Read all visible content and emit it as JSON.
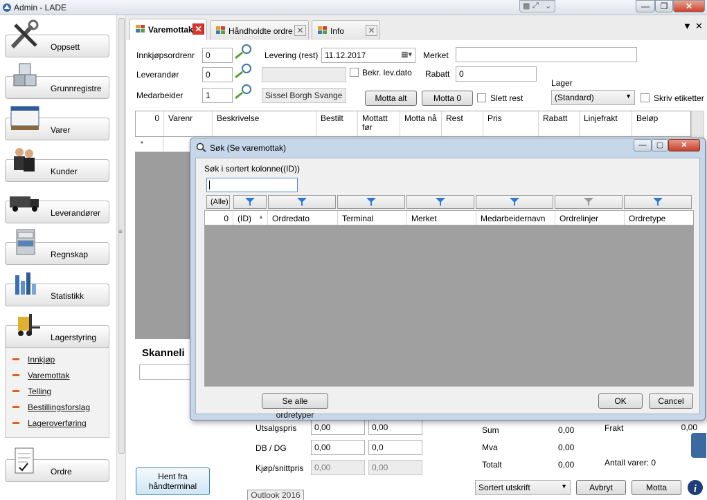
{
  "window": {
    "title": "Admin - LADE",
    "minimize": "—",
    "maximize": "❐",
    "close": "✕"
  },
  "nav": {
    "items": [
      {
        "label": "Oppsett",
        "icon": "tools-icon"
      },
      {
        "label": "Grunnregistre",
        "icon": "cubes-icon"
      },
      {
        "label": "Varer",
        "icon": "pallet-icon"
      },
      {
        "label": "Kunder",
        "icon": "people-icon"
      },
      {
        "label": "Leverandører",
        "icon": "truck-icon"
      },
      {
        "label": "Regnskap",
        "icon": "cabinet-icon"
      },
      {
        "label": "Statistikk",
        "icon": "bar-chart-icon"
      },
      {
        "label": "Lagerstyring",
        "icon": "forklift-icon"
      },
      {
        "label": "Ordre",
        "icon": "document-icon"
      }
    ],
    "sub_items": [
      "Innkjøp",
      "Varemottak",
      "Telling",
      "Bestillingsforslag",
      "Lageroverføring"
    ]
  },
  "tabs": [
    {
      "label": "Varemottak",
      "active": true
    },
    {
      "label": "Håndholdte ordre",
      "active": false
    },
    {
      "label": "Info",
      "active": false
    }
  ],
  "form": {
    "innkjopsordrenr_label": "Innkjøpsordrenr",
    "innkjopsordrenr_value": "0",
    "leverandor_label": "Leverandør",
    "leverandor_value": "0",
    "medarbeider_label": "Medarbeider",
    "medarbeider_value": "1",
    "medarbeider_name": "Sissel Borgh Svange",
    "levering_label": "Levering (rest)",
    "levering_value": "11.12.2017",
    "bekr_label": "Bekr. lev.dato",
    "merket_label": "Merket",
    "merket_value": "",
    "rabatt_label": "Rabatt",
    "rabatt_value": "0",
    "lager_label": "Lager",
    "lager_value": "(Standard)",
    "motta_alt": "Motta alt",
    "motta_0": "Motta 0",
    "slett_rest": "Slett rest",
    "skriv_etiketter": "Skriv etiketter"
  },
  "grid": {
    "count": "0",
    "columns": [
      "Varenr",
      "Beskrivelse",
      "Bestilt",
      "Mottatt før",
      "Motta nå",
      "Rest",
      "Pris",
      "Rabatt",
      "Linjefrakt",
      "Beløp"
    ],
    "new_row_marker": "*"
  },
  "scanner": {
    "label": "Skanneli"
  },
  "bottom": {
    "utsalgspris_label": "Utsalgspris",
    "utsalgspris_1": "0,00",
    "utsalgspris_2": "0,00",
    "db_label": "DB / DG",
    "db_1": "0,00",
    "db_2": "0,0",
    "kjop_label": "Kjøp/snittpris",
    "kjop_1": "0,00",
    "kjop_2": "0,00",
    "sum_label": "Sum",
    "sum_value": "0,00",
    "mva_label": "Mva",
    "mva_value": "0,00",
    "totalt_label": "Totalt",
    "totalt_value": "0,00",
    "frakt_label": "Frakt",
    "frakt_value": "0,00",
    "antall_label": "Antall varer: 0",
    "hent_button": "Hent fra\nhåndterminal",
    "outlook_label": "Outlook 2016",
    "print_select": "Sortert utskrift",
    "avbryt": "Avbryt",
    "motta": "Motta"
  },
  "dialog": {
    "title": "Søk (Se varemottak)",
    "search_label": "Søk i sortert kolonne",
    "sort_column": "((ID))",
    "search_value": "",
    "alle_button": "(Alle)",
    "count": "0",
    "columns": [
      "(ID)",
      "Ordredato",
      "Terminal",
      "Merket",
      "Medarbeidernavn",
      "Ordrelinjer",
      "Ordretype"
    ],
    "se_alle": "Se alle ordretyper",
    "ok": "OK",
    "cancel": "Cancel"
  }
}
